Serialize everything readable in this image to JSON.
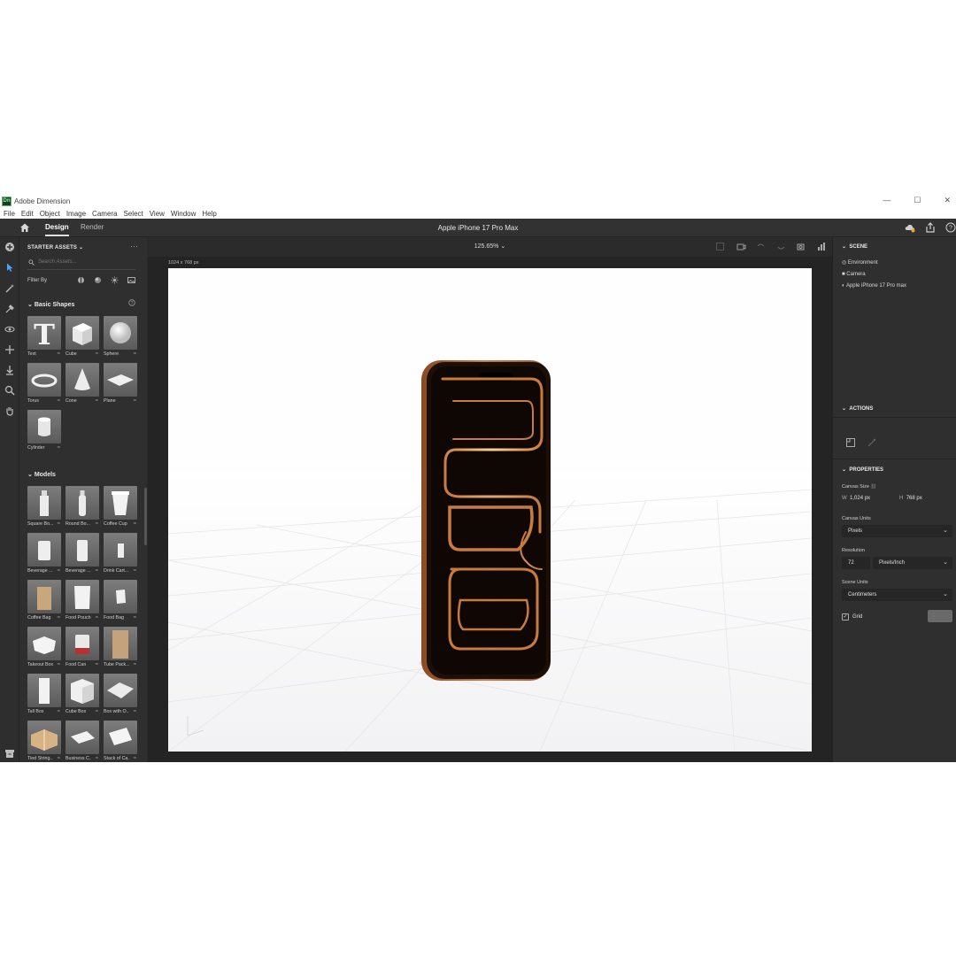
{
  "window": {
    "app_title": "Adobe Dimension",
    "logo_text": "Dn",
    "controls": {
      "minimize": "—",
      "maximize": "☐",
      "close": "✕"
    }
  },
  "menu": [
    "File",
    "Edit",
    "Object",
    "Image",
    "Camera",
    "Select",
    "View",
    "Window",
    "Help"
  ],
  "appbar": {
    "tabs": [
      "Design",
      "Render"
    ],
    "active_tab": "Design",
    "document_title": "Apple iPhone 17 Pro Max"
  },
  "assets": {
    "header": "STARTER ASSETS",
    "more": "···",
    "search_placeholder": "Search Assets...",
    "filter_label": "Filter By",
    "basic_shapes": {
      "title": "Basic Shapes",
      "help": "?",
      "items": [
        "Text",
        "Cube",
        "Sphere",
        "Torus",
        "Cone",
        "Plane",
        "Cylinder"
      ]
    },
    "models": {
      "title": "Models",
      "items": [
        "Square Bo...",
        "Round Bo...",
        "Coffee Cup",
        "Beverage ...",
        "Beverage ...",
        "Drink Cart...",
        "Coffee Bag",
        "Food Pouch",
        "Food Bag",
        "Takeout Box",
        "Food Can",
        "Tube Pack...",
        "Tall Box",
        "Cube Box",
        "Box with O...",
        "Tied String...",
        "Business C...",
        "Stack of Ca..."
      ]
    }
  },
  "viewport": {
    "zoom": "125.65%",
    "canvas_size_label": "1024 x 768 px"
  },
  "scene": {
    "title": "SCENE",
    "items": [
      "Environment",
      "Camera",
      "Apple iPhone 17 Pro max"
    ]
  },
  "actions": {
    "title": "ACTIONS"
  },
  "properties": {
    "title": "PROPERTIES",
    "canvas_size_label": "Canvas Size",
    "width_label": "W",
    "width_value": "1,024 px",
    "height_label": "H",
    "height_value": "768 px",
    "canvas_units_label": "Canvas Units",
    "canvas_units_value": "Pixels",
    "resolution_label": "Resolution",
    "resolution_value": "72",
    "resolution_units": "Pixels/Inch",
    "scene_units_label": "Scene Units",
    "scene_units_value": "Centimeters",
    "grid_label": "Grid",
    "grid_checked": true
  },
  "colors": {
    "accent": "#c98a57",
    "ui_bg": "#2f2f2f",
    "canvas": "#fefefe"
  }
}
